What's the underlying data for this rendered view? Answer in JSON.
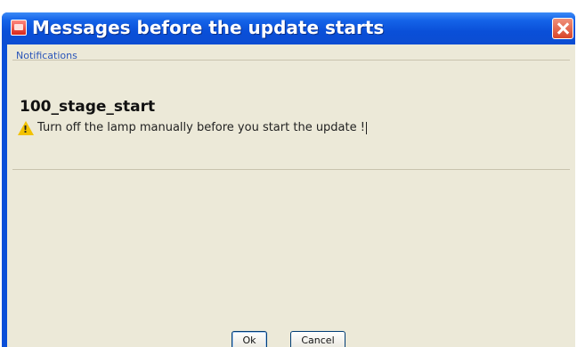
{
  "window": {
    "title": "Messages before the update starts",
    "title_icon": "app-icon",
    "close_icon": "close-icon",
    "accent_color": "#0a4fd8"
  },
  "notifications": {
    "section_label": "Notifications",
    "stage_name": "100_stage_start",
    "message": {
      "icon": "warning-icon",
      "text": "Turn off the lamp manually before you start the update !"
    }
  },
  "buttons": {
    "ok_label": "Ok",
    "cancel_label": "Cancel"
  }
}
